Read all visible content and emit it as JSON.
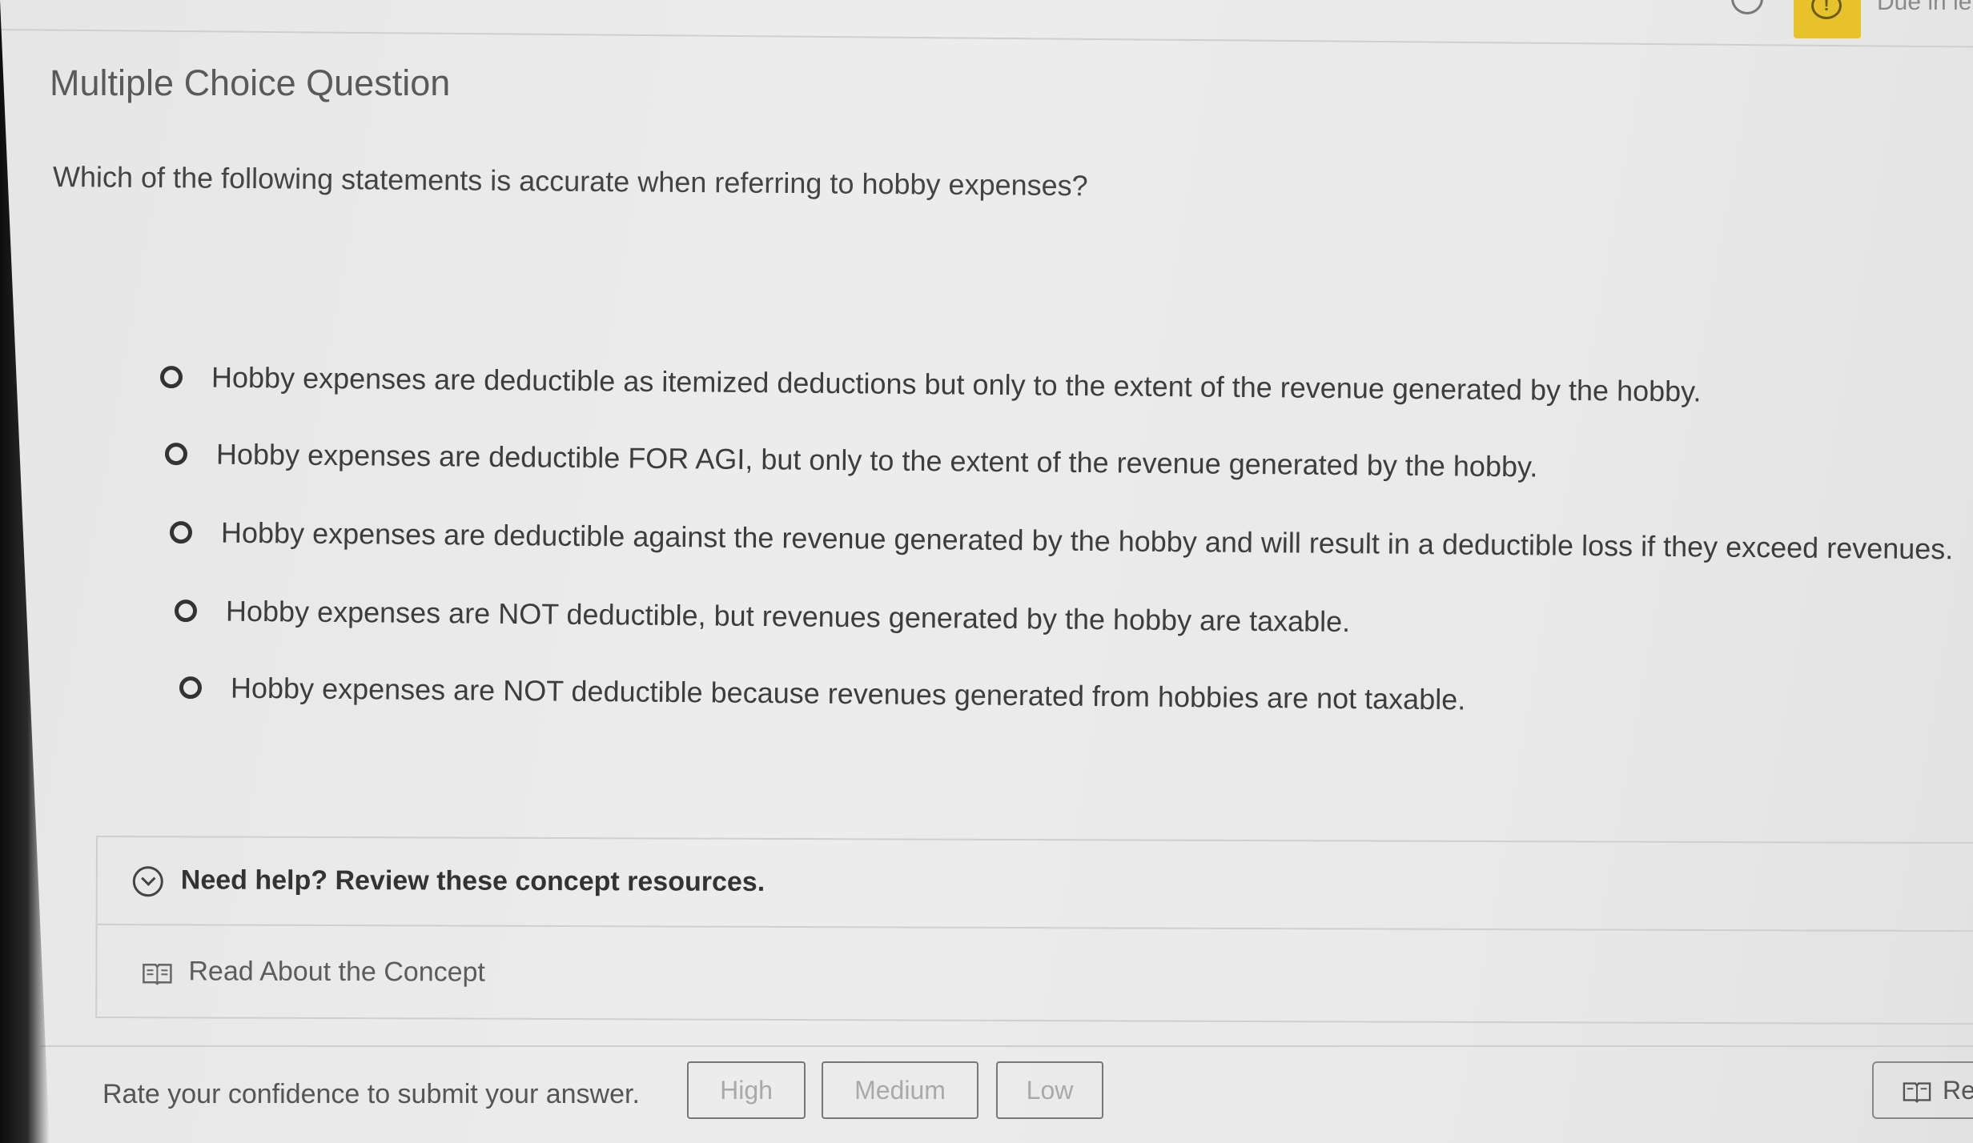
{
  "header": {
    "due_text": "Due in le"
  },
  "question": {
    "type_label": "Multiple Choice Question",
    "prompt": "Which of the following statements is accurate when referring to hobby expenses?",
    "options": [
      {
        "label": "Hobby expenses are deductible as itemized deductions but only to the extent of the revenue generated by the hobby."
      },
      {
        "label": "Hobby expenses are deductible FOR AGI, but only to the extent of the revenue generated by the hobby."
      },
      {
        "label": "Hobby expenses are deductible against the revenue generated by the hobby and will result in a deductible loss if they exceed revenues."
      },
      {
        "label": "Hobby expenses are NOT deductible, but revenues generated by the hobby are taxable."
      },
      {
        "label": "Hobby expenses are NOT deductible because revenues generated from hobbies are not taxable."
      }
    ]
  },
  "help": {
    "title": "Need help? Review these concept resources.",
    "read_link": "Read About the Concept"
  },
  "footer": {
    "rate_prompt": "Rate your confidence to submit your answer.",
    "confidence_buttons": [
      "High",
      "Medium",
      "Low"
    ],
    "reader_label": "Re"
  },
  "icons": {
    "timer": "timer-icon",
    "alert": "alert-icon",
    "chevron": "chevron-down-icon",
    "book": "book-icon"
  },
  "colors": {
    "alert_yellow": "#e8c22a",
    "background": "#e9e9e9"
  }
}
